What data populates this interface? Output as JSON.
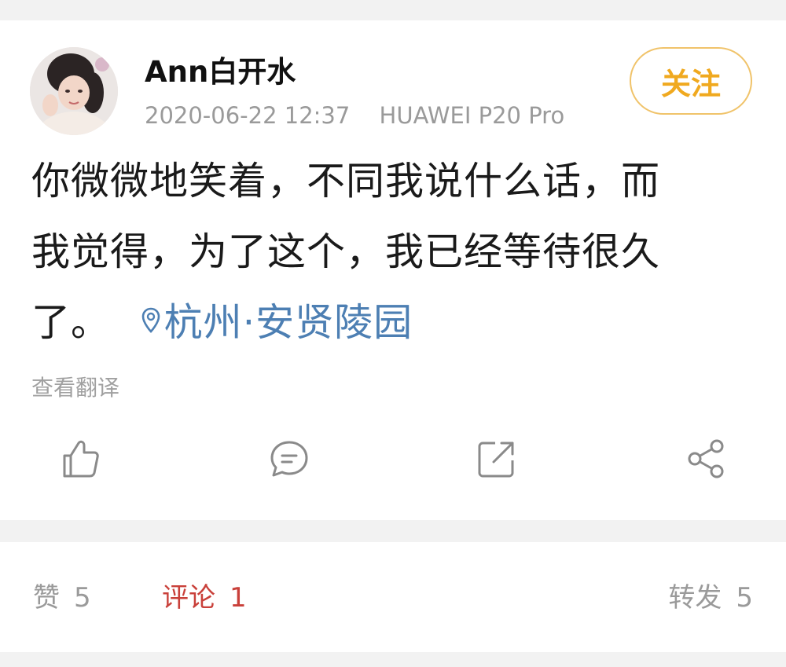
{
  "post": {
    "username": "Ann白开水",
    "timestamp": "2020-06-22 12:37",
    "device": "HUAWEI P20 Pro",
    "follow_label": "关注",
    "text_lines": [
      "你微微地笑着，不同我说什么话，而",
      "我觉得，为了这个，我已经等待很久",
      "了。"
    ],
    "location": "杭州·安贤陵园",
    "translate_label": "查看翻译"
  },
  "actions": {
    "icons": [
      "thumbs-up-icon",
      "comment-icon",
      "repost-icon",
      "share-icon"
    ]
  },
  "stats": {
    "likes_label": "赞",
    "likes_count": "5",
    "comments_label": "评论",
    "comments_count": "1",
    "reposts_label": "转发",
    "reposts_count": "5"
  },
  "colors": {
    "follow_accent": "#f0a91f",
    "location_link": "#4d7fb3",
    "active_tab": "#c9403a",
    "muted_text": "#9a9a9a"
  }
}
